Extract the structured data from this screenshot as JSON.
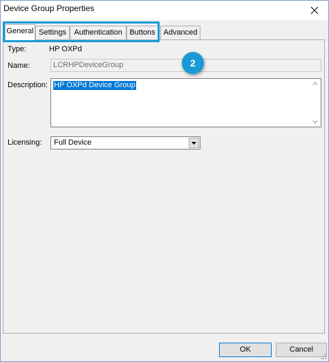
{
  "window": {
    "title": "Device Group Properties"
  },
  "tabs": [
    {
      "label": "General",
      "active": true
    },
    {
      "label": "Settings",
      "active": false
    },
    {
      "label": "Authentication",
      "active": false
    },
    {
      "label": "Buttons",
      "active": false
    },
    {
      "label": "Advanced",
      "active": false
    }
  ],
  "form": {
    "type_label": "Type:",
    "type_value": "HP OXPd",
    "name_label": "Name:",
    "name_value": "LCRHPDeviceGroup",
    "description_label": "Description:",
    "description_value": "HP OXPd Device Group",
    "licensing_label": "Licensing:",
    "licensing_value": "Full Device"
  },
  "buttons": {
    "ok": "OK",
    "cancel": "Cancel"
  },
  "callout": {
    "number": "2"
  },
  "colors": {
    "accent": "#1a9ad6",
    "selection": "#0078d7"
  }
}
